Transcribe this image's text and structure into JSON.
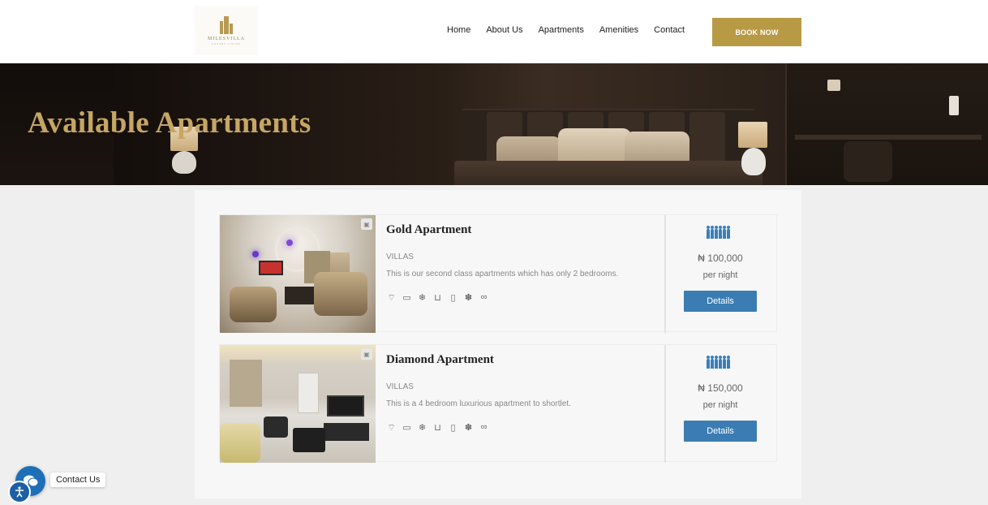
{
  "header": {
    "logo_text": "MILESVILLA",
    "logo_subtext": "LUXURY LIVING",
    "nav": [
      "Home",
      "About Us",
      "Apartments",
      "Amenities",
      "Contact"
    ],
    "book_label": "BOOK NOW"
  },
  "hero": {
    "title": "Available Apartments"
  },
  "apartments": [
    {
      "title": "Gold Apartment",
      "category": "VILLAS",
      "description": "This is our second class apartments which has only 2 bedrooms.",
      "amenities": [
        "wifi-icon",
        "tv-icon",
        "snowflake-icon",
        "bath-icon",
        "coffee-icon",
        "paw-icon",
        "parking-icon"
      ],
      "guests": 6,
      "price": "₦ 100,000",
      "per_night": "per night",
      "details_label": "Details"
    },
    {
      "title": "Diamond Apartment",
      "category": "VILLAS",
      "description": "This is a 4 bedroom luxurious apartment to shortlet.",
      "amenities": [
        "wifi-icon",
        "tv-icon",
        "snowflake-icon",
        "bath-icon",
        "coffee-icon",
        "paw-icon",
        "parking-icon"
      ],
      "guests": 6,
      "price": "₦ 150,000",
      "per_night": "per night",
      "details_label": "Details"
    }
  ],
  "chat": {
    "label": "Contact Us"
  },
  "colors": {
    "gold": "#b89a44",
    "hero_title": "#c6a664",
    "blue": "#3b7db3"
  }
}
